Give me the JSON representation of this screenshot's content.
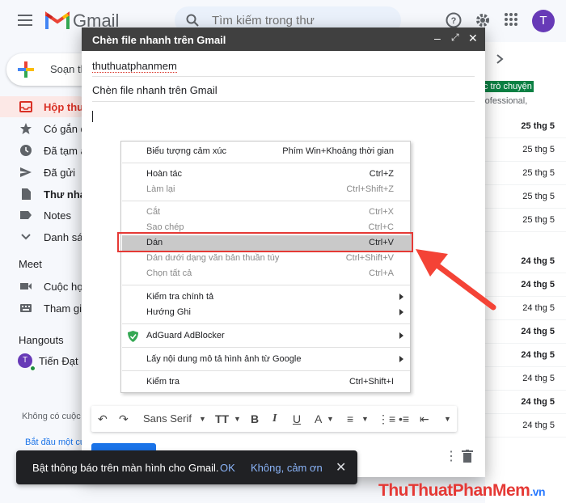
{
  "header": {
    "app_name": "Gmail",
    "search_placeholder": "Tìm kiếm trong thư",
    "avatar_letter": "T"
  },
  "sidebar": {
    "compose_label": "Soạn thư",
    "items": [
      {
        "label": "Hộp thư",
        "icon": "inbox-icon"
      },
      {
        "label": "Có gắn dấu",
        "icon": "star-icon"
      },
      {
        "label": "Đã tạm ẩn",
        "icon": "clock-icon"
      },
      {
        "label": "Đã gửi",
        "icon": "send-icon"
      },
      {
        "label": "Thư nháp",
        "icon": "draft-icon"
      },
      {
        "label": "Notes",
        "icon": "label-icon"
      },
      {
        "label": "Danh sách",
        "icon": "chevron-down-icon"
      }
    ],
    "meet_heading": "Meet",
    "meet_items": [
      {
        "label": "Cuộc họp",
        "icon": "video-icon"
      },
      {
        "label": "Tham gia",
        "icon": "keyboard-icon"
      }
    ],
    "hangouts_heading": "Hangouts",
    "hangouts_user": "Tiến Đạt",
    "hangouts_avatar": "T",
    "no_chats_text": "Không có cuộc",
    "start_link": "Bắt đầu một cu"
  },
  "mail_list": {
    "tag_text": "c trò chuyện",
    "snippet": "rofessional,",
    "dates": [
      "25 thg 5",
      "25 thg 5",
      "25 thg 5",
      "25 thg 5",
      "25 thg 5",
      "24 thg 5",
      "24 thg 5",
      "24 thg 5",
      "24 thg 5",
      "24 thg 5",
      "24 thg 5",
      "24 thg 5",
      "24 thg 5"
    ]
  },
  "compose": {
    "title": "Chèn file nhanh trên Gmail",
    "to_value": "thuthuatphanmem",
    "subject": "Chèn file nhanh trên Gmail",
    "font_name": "Sans Serif"
  },
  "context_menu": {
    "items": [
      {
        "label": "Biểu tượng cảm xúc",
        "shortcut": "Phím Win+Khoảng thời gian"
      },
      {
        "label": "Hoàn tác",
        "shortcut": "Ctrl+Z"
      },
      {
        "label": "Làm lại",
        "shortcut": "Ctrl+Shift+Z"
      },
      {
        "label": "Cắt",
        "shortcut": "Ctrl+X"
      },
      {
        "label": "Sao chép",
        "shortcut": "Ctrl+C"
      },
      {
        "label": "Dán",
        "shortcut": "Ctrl+V"
      },
      {
        "label": "Dán dưới dạng văn bản thuần túy",
        "shortcut": "Ctrl+Shift+V"
      },
      {
        "label": "Chọn tất cả",
        "shortcut": "Ctrl+A"
      },
      {
        "label": "Kiểm tra chính tả",
        "shortcut": ""
      },
      {
        "label": "Hướng Ghi",
        "shortcut": ""
      },
      {
        "label": "AdGuard AdBlocker",
        "shortcut": ""
      },
      {
        "label": "Lấy nội dung mô tả hình ảnh từ Google",
        "shortcut": ""
      },
      {
        "label": "Kiểm tra",
        "shortcut": "Ctrl+Shift+I"
      }
    ]
  },
  "snackbar": {
    "text": "Bật thông báo trên màn hình cho Gmail.",
    "ok": "OK",
    "no": "Không, cảm ơn"
  },
  "watermark": {
    "text": "ThuThuatPhanMem",
    "suffix": ".vn"
  },
  "colors": {
    "accent_red": "#e53935",
    "gmail_blue": "#1a73e8",
    "compose_header": "#404040"
  }
}
